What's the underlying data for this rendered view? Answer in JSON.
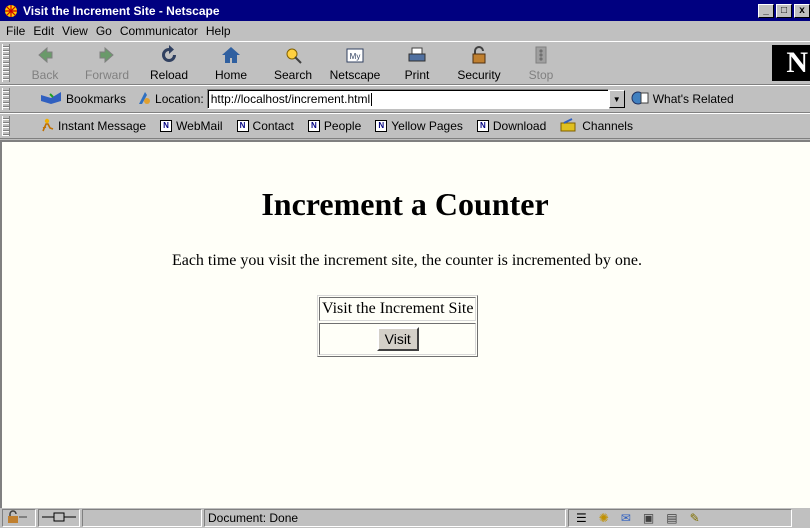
{
  "window": {
    "title": "Visit the Increment Site - Netscape"
  },
  "menu": [
    "File",
    "Edit",
    "View",
    "Go",
    "Communicator",
    "Help"
  ],
  "navigation": {
    "buttons": [
      {
        "label": "Back",
        "icon": "back-arrow-icon",
        "enabled": false
      },
      {
        "label": "Forward",
        "icon": "forward-arrow-icon",
        "enabled": false
      },
      {
        "label": "Reload",
        "icon": "reload-icon",
        "enabled": true
      },
      {
        "label": "Home",
        "icon": "home-icon",
        "enabled": true
      },
      {
        "label": "Search",
        "icon": "search-icon",
        "enabled": true
      },
      {
        "label": "Netscape",
        "icon": "netscape-icon",
        "enabled": true
      },
      {
        "label": "Print",
        "icon": "print-icon",
        "enabled": true
      },
      {
        "label": "Security",
        "icon": "lock-icon",
        "enabled": true
      },
      {
        "label": "Stop",
        "icon": "stop-icon",
        "enabled": false
      }
    ]
  },
  "location": {
    "bookmarks_label": "Bookmarks",
    "location_label": "Location:",
    "url": "http://localhost/increment.html",
    "related_label": "What's Related"
  },
  "personal_toolbar": [
    "Instant Message",
    "WebMail",
    "Contact",
    "People",
    "Yellow Pages",
    "Download",
    "Channels"
  ],
  "page": {
    "heading": "Increment a Counter",
    "description": "Each time you visit the increment site, the counter is incremented by one.",
    "table_header": "Visit the Increment Site",
    "button_label": "Visit"
  },
  "status": {
    "text": "Document: Done"
  },
  "colors": {
    "titlebar": "#000080",
    "chrome": "#c0c0c0",
    "page_background": "#fffff8"
  }
}
